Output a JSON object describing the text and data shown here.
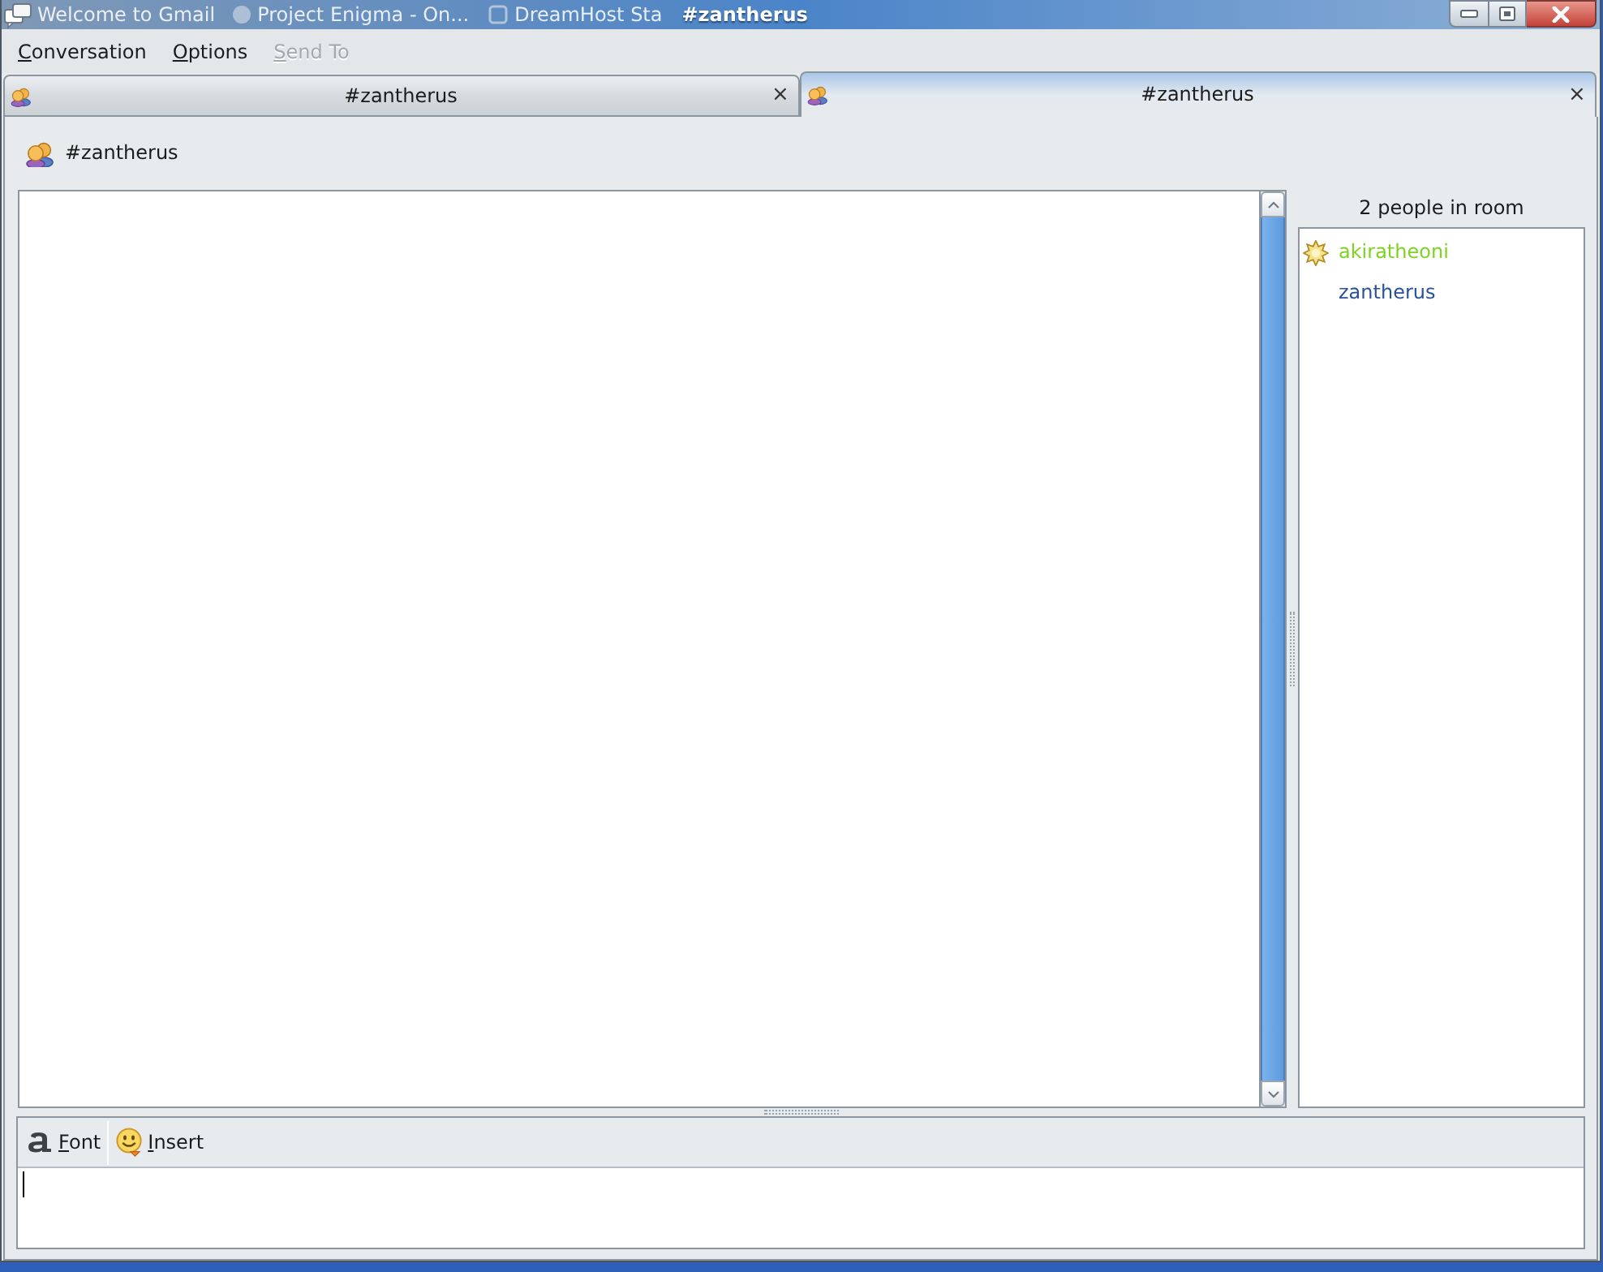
{
  "window": {
    "title": "#zantherus",
    "behind_titles": [
      {
        "label": "Welcome to Gmail",
        "kind": "plain"
      },
      {
        "label": "Project Enigma - On...",
        "kind": "dot"
      },
      {
        "label": "DreamHost Sta",
        "kind": "page"
      }
    ]
  },
  "menu": [
    {
      "label": "Conversation",
      "disabled": false
    },
    {
      "label": "Options",
      "disabled": false
    },
    {
      "label": "Send To",
      "disabled": true
    }
  ],
  "tabs": [
    {
      "label": "#zantherus",
      "close": "×",
      "selected": false
    },
    {
      "label": "#zantherus",
      "close": "×",
      "selected": true
    }
  ],
  "conversation": {
    "title": "#zantherus"
  },
  "people": {
    "heading": "2 people in room",
    "members": [
      {
        "name": "akiratheoni",
        "kind": "operator",
        "color": "#7ed321"
      },
      {
        "name": "zantherus",
        "kind": "member",
        "color": "#2a519c"
      }
    ]
  },
  "toolbar": [
    {
      "label": "Font",
      "kind": "font"
    },
    {
      "label": "Insert",
      "kind": "smiley"
    }
  ]
}
